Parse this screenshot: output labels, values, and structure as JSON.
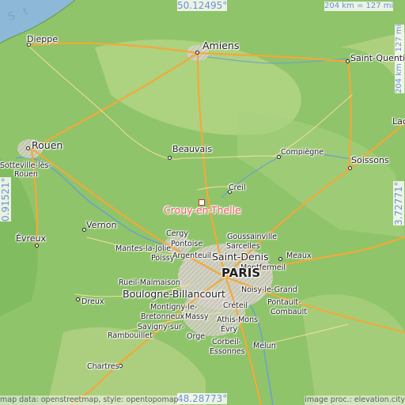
{
  "map": {
    "colors": {
      "land": "#8fc46a",
      "highland": "#c8d890",
      "sea": "#8db8d8",
      "roads": "#f3a83a",
      "urban": "#d6d6d6",
      "label": "#1e1e1e",
      "highlight": "#ea5959",
      "coordinate_text": "#6f8fd8"
    },
    "coordinates": {
      "top_latitude": "50.12495°",
      "bottom_latitude": "48.28773°",
      "left_longitude": "0.91521°",
      "right_longitude": "3.72771°"
    },
    "scale": {
      "top": "204 km = 127 mi",
      "right": "204 km = 127 mi"
    },
    "sea_label": "S t",
    "highlighted_place": "Crouy-en-Thelle",
    "places": {
      "amiens": "Amiens",
      "dieppe": "Dieppe",
      "saint_quentin": "Saint-Quentin",
      "rouen": "Rouen",
      "sotteville": "Sotteville-lès-",
      "sotteville2": "Rouen",
      "beauvais": "Beauvais",
      "compiegne": "Compiègne",
      "soissons": "Soissons",
      "creil": "Creil",
      "evreux": "Évreux",
      "vernon": "Vernon",
      "cergy": "Cergy",
      "pontoise": "Pontoise",
      "goussainville": "Goussainville",
      "sarcelles": "Sarcelles",
      "mantes": "Mantes-la-Jolie",
      "poissy": "Poissy",
      "argenteuil": "Argenteuil",
      "saint_denis": "Saint-Denis",
      "meaux": "Meaux",
      "montfermeil": "Montfermeil",
      "paris": "PARIS",
      "rueil": "Rueil-Malmaison",
      "noisy": "Noisy-le-Grand",
      "boulogne": "Boulogne-Billancourt",
      "dreux": "Dreux",
      "montigny": "Montigny-le-",
      "bretonneux": "Bretonneux",
      "creteil": "Créteil",
      "massy": "Massy",
      "pontault": "Pontault-",
      "combault": "Combault",
      "athis": "Athis-Mons",
      "savigny": "Savigny-sur-",
      "orge": "Orge",
      "evry": "Évry",
      "rambouillet": "Rambouillet",
      "corbeil": "Corbeil-",
      "essonnes": "Essonnes",
      "melun": "Melun",
      "chartres": "Chartres",
      "lac": "Lac"
    },
    "attribution_left": "map data: openstreetmap, style: opentopomap",
    "attribution_right": "image proc.: elevation.city"
  }
}
